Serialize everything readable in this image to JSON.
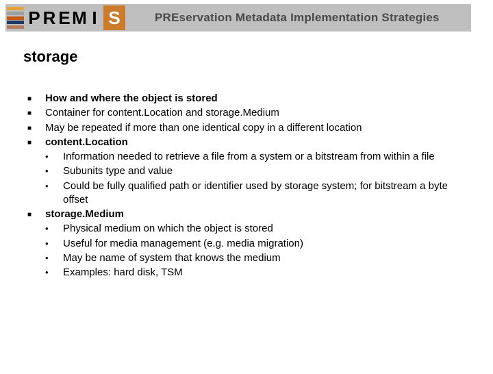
{
  "banner": {
    "logo_letters": [
      "P",
      "R",
      "E",
      "M",
      "I"
    ],
    "logo_block": "S",
    "title": "PREservation Metadata Implementation Strategies"
  },
  "slide": {
    "title": "storage",
    "items": [
      {
        "bold": true,
        "text": "How and where the object is stored"
      },
      {
        "bold": false,
        "text": "Container for content.Location and storage.Medium"
      },
      {
        "bold": false,
        "text": "May be repeated if more than one identical copy in a different location"
      },
      {
        "bold": true,
        "text": "content.Location",
        "sub": [
          "Information needed to retrieve a file from a system or a bitstream from within a file",
          "Subunits type and value",
          "Could be fully qualified path or identifier used by storage system; for bitstream a byte offset"
        ]
      },
      {
        "bold": true,
        "text": "storage.Medium",
        "sub": [
          "Physical medium on which the object is stored",
          "Useful for media management (e.g. media migration)",
          "May be name of system that knows the medium",
          "Examples: hard disk, TSM"
        ]
      }
    ]
  }
}
